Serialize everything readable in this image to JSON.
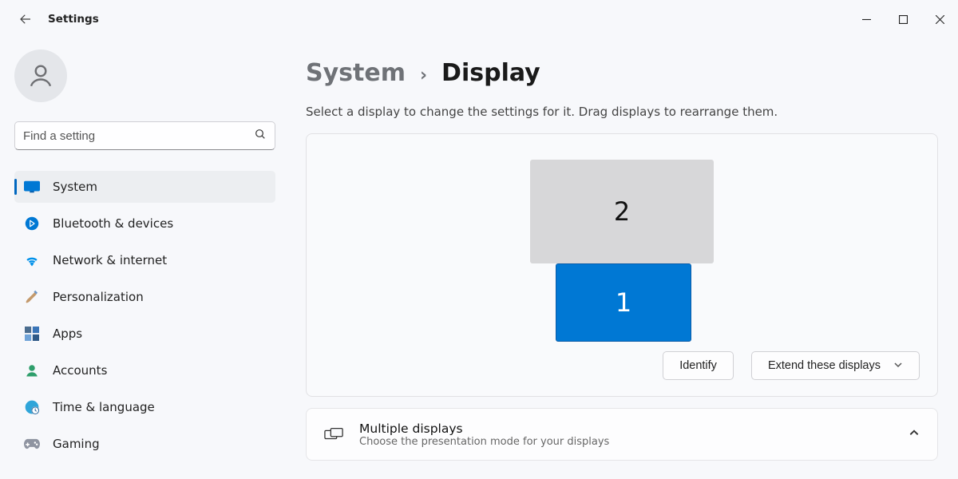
{
  "window": {
    "title": "Settings"
  },
  "sidebar": {
    "search_placeholder": "Find a setting",
    "items": [
      {
        "label": "System"
      },
      {
        "label": "Bluetooth & devices"
      },
      {
        "label": "Network & internet"
      },
      {
        "label": "Personalization"
      },
      {
        "label": "Apps"
      },
      {
        "label": "Accounts"
      },
      {
        "label": "Time & language"
      },
      {
        "label": "Gaming"
      }
    ]
  },
  "main": {
    "breadcrumb_parent": "System",
    "breadcrumb_current": "Display",
    "hint": "Select a display to change the settings for it. Drag displays to rearrange them.",
    "displays": {
      "d1_label": "1",
      "d2_label": "2"
    },
    "identify_label": "Identify",
    "mode_label": "Extend these displays",
    "multiple_displays": {
      "title": "Multiple displays",
      "subtitle": "Choose the presentation mode for your displays"
    }
  }
}
